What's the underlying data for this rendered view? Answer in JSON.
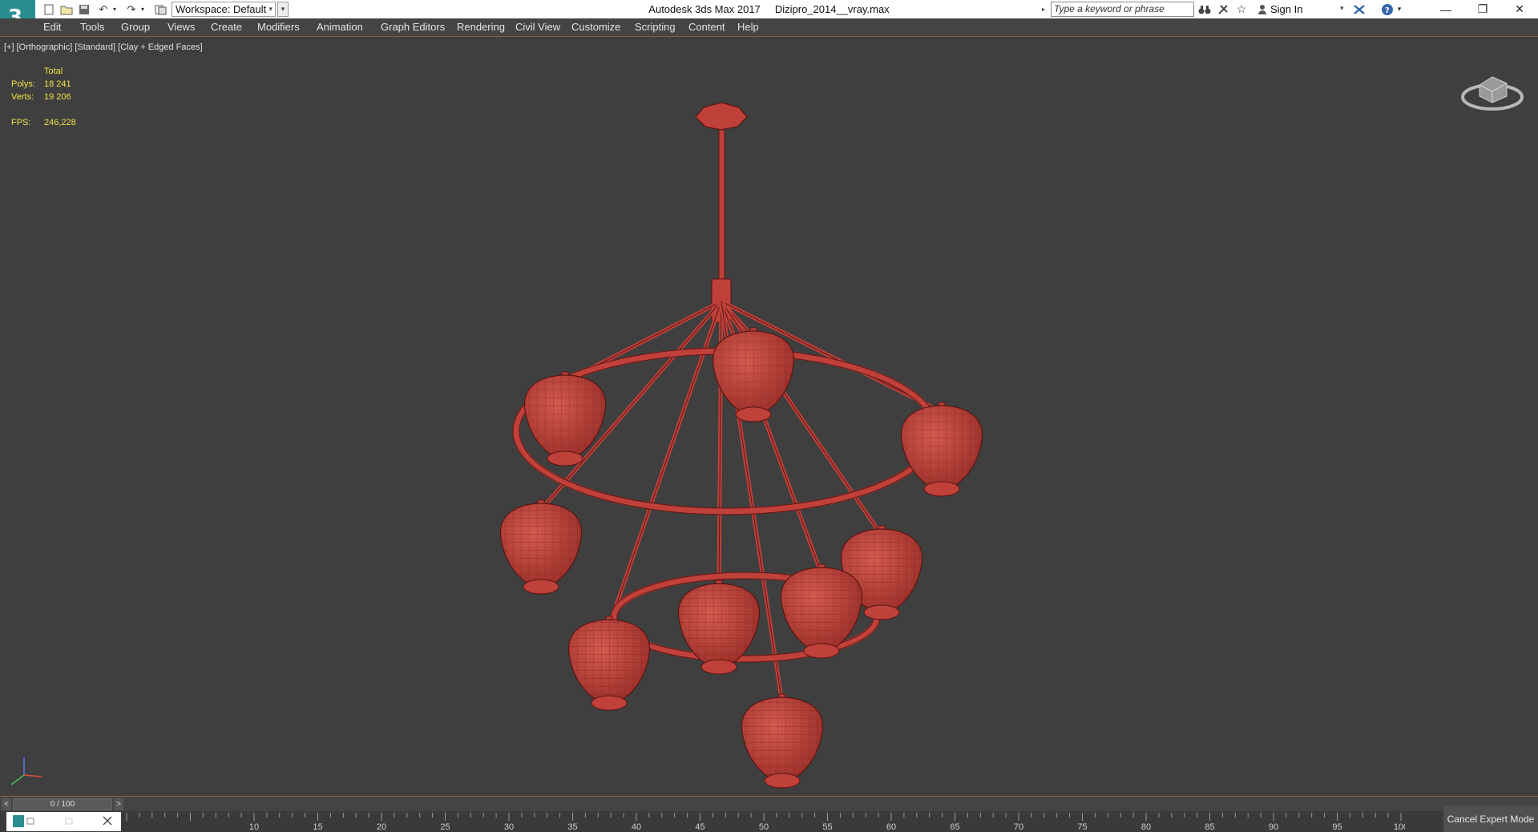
{
  "titlebar": {
    "workspace": "Workspace: Default",
    "app_name": "Autodesk 3ds Max 2017",
    "file_name": "Dizipro_2014__vray.max",
    "search_placeholder": "Type a keyword or phrase",
    "sign_in": "Sign In"
  },
  "menu": [
    "Edit",
    "Tools",
    "Group",
    "Views",
    "Create",
    "Modifiers",
    "Animation",
    "Graph Editors",
    "Rendering",
    "Civil View",
    "Customize",
    "Scripting",
    "Content",
    "Help"
  ],
  "viewport": {
    "label": "[+] [Orthographic] [Standard] [Clay + Edged Faces]",
    "stats": {
      "total_label": "Total",
      "polys_label": "Polys:",
      "polys_value": "18 241",
      "verts_label": "Verts:",
      "verts_value": "19 206",
      "fps_label": "FPS:",
      "fps_value": "246,228"
    }
  },
  "timeslider": {
    "position": "0 / 100",
    "prev": "<",
    "next": ">"
  },
  "ruler_ticks": [
    "10",
    "15",
    "20",
    "25",
    "30",
    "35",
    "40",
    "45",
    "50",
    "55",
    "60",
    "65",
    "70",
    "75",
    "80",
    "85",
    "90",
    "95",
    "100"
  ],
  "cancel_expert": "Cancel Expert Mode",
  "colors": {
    "model": "#c0403a",
    "model_edge": "#5a1512",
    "stats_text": "#f1e246",
    "viewport_bg": "#3f3f3f"
  }
}
